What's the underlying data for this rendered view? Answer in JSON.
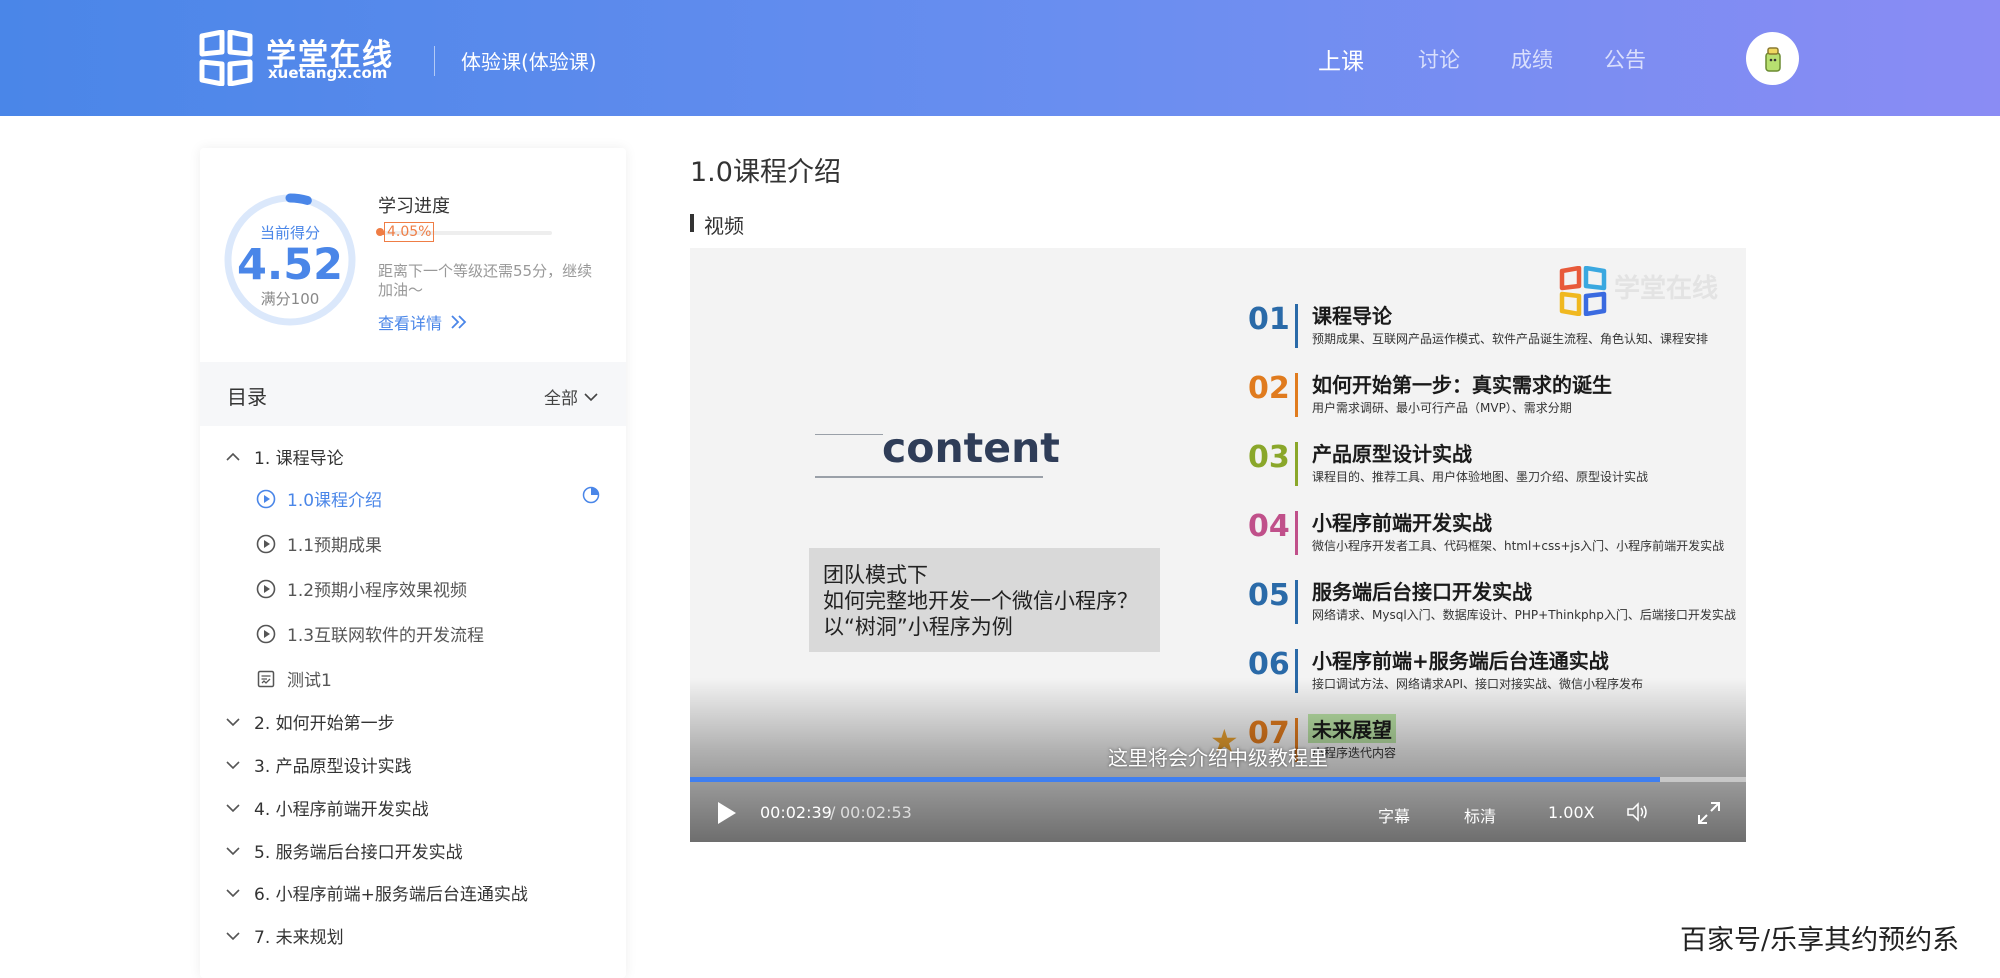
{
  "header": {
    "brand_cn": "学堂在线",
    "brand_en": "xuetangx.com",
    "course_name": "体验课(体验课)",
    "nav": [
      {
        "label": "上课",
        "active": true
      },
      {
        "label": "讨论",
        "active": false
      },
      {
        "label": "成绩",
        "active": false
      },
      {
        "label": "公告",
        "active": false
      }
    ],
    "avatar_icon": "avatar-icon"
  },
  "score": {
    "label": "当前得分",
    "value": "4.52",
    "full": "满分100",
    "ring_fraction": 0.0452
  },
  "progress": {
    "title": "学习进度",
    "percent_text": "4.05%",
    "percent": 4.05,
    "tip": "距离下一个等级还需55分，继续加油～",
    "detail_link": "查看详情"
  },
  "toc": {
    "title": "目录",
    "filter": "全部",
    "chapters": [
      {
        "label": "1. 课程导论",
        "expanded": true
      },
      {
        "label": "2. 如何开始第一步",
        "expanded": false
      },
      {
        "label": "3. 产品原型设计实践",
        "expanded": false
      },
      {
        "label": "4. 小程序前端开发实战",
        "expanded": false
      },
      {
        "label": "5. 服务端后台接口开发实战",
        "expanded": false
      },
      {
        "label": "6. 小程序前端+服务端后台连通实战",
        "expanded": false
      },
      {
        "label": "7. 未来规划",
        "expanded": false
      }
    ],
    "lessons": [
      {
        "label": "1.0课程介绍",
        "icon": "play-circle-icon",
        "active": true
      },
      {
        "label": "1.1预期成果",
        "icon": "play-circle-icon",
        "active": false
      },
      {
        "label": "1.2预期小程序效果视频",
        "icon": "play-circle-icon",
        "active": false
      },
      {
        "label": "1.3互联网软件的开发流程",
        "icon": "play-circle-icon",
        "active": false
      },
      {
        "label": "测试1",
        "icon": "quiz-icon",
        "active": false
      }
    ]
  },
  "main": {
    "lesson_title": "1.0课程介绍",
    "section_label": "视频"
  },
  "slide": {
    "content_word": "content",
    "team_lines": [
      "团队模式下",
      "如何完整地开发一个微信小程序？",
      "以“树洞”小程序为例"
    ],
    "brand": "学堂在线",
    "items": [
      {
        "num": "01",
        "color": "#2a6aa8",
        "title": "课程导论",
        "sub": "预期成果、互联网产品运作模式、软件产品诞生流程、角色认知、课程安排"
      },
      {
        "num": "02",
        "color": "#e07b1e",
        "title": "如何开始第一步：真实需求的诞生",
        "sub": "用户需求调研、最小可行产品（MVP）、需求分期"
      },
      {
        "num": "03",
        "color": "#8aa72a",
        "title": "产品原型设计实战",
        "sub": "课程目的、推荐工具、用户体验地图、墨刀介绍、原型设计实战"
      },
      {
        "num": "04",
        "color": "#c0508a",
        "title": "小程序前端开发实战",
        "sub": "微信小程序开发者工具、代码框架、html+css+js入门、小程序前端开发实战"
      },
      {
        "num": "05",
        "color": "#2a6aa8",
        "title": "服务端后台接口开发实战",
        "sub": "网络请求、Mysql入门、数据库设计、PHP+Thinkphp入门、后端接口开发实战"
      },
      {
        "num": "06",
        "color": "#2a6aa8",
        "title": "小程序前端+服务端后台连通实战",
        "sub": "接口调试方法、网络请求API、接口对接实战、微信小程序发布"
      },
      {
        "num": "07",
        "color": "#e07b1e",
        "title": "未来展望",
        "sub": "小程序迭代内容"
      }
    ]
  },
  "player": {
    "subtitle": "这里将会介绍中级教程里",
    "time_current": "00:02:39",
    "time_separator": "/",
    "time_total": "00:02:53",
    "progress_fraction": 0.919,
    "caption_label": "字幕",
    "quality_label": "标清",
    "speed_label": "1.00X"
  },
  "watermark": "百家号/乐享其约预约系",
  "colors": {
    "accent": "#4a86e8",
    "progress": "#ef7d45"
  }
}
